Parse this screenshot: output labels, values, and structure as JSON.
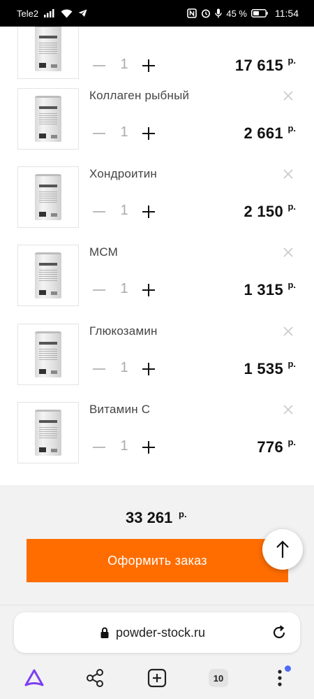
{
  "status_bar": {
    "carrier": "Tele2",
    "battery": "45 %",
    "time": "11:54"
  },
  "cart": {
    "currency": "р.",
    "items": [
      {
        "name": "",
        "qty": "1",
        "price": "17 615"
      },
      {
        "name": "Коллаген рыбный",
        "qty": "1",
        "price": "2 661"
      },
      {
        "name": "Хондроитин",
        "qty": "1",
        "price": "2 150"
      },
      {
        "name": "МСМ",
        "qty": "1",
        "price": "1 315"
      },
      {
        "name": "Глюкозамин",
        "qty": "1",
        "price": "1 535"
      },
      {
        "name": "Витамин С",
        "qty": "1",
        "price": "776"
      }
    ]
  },
  "summary": {
    "total": "33 261",
    "currency": "р.",
    "checkout_label": "Оформить заказ"
  },
  "browser": {
    "url": "powder-stock.ru",
    "tabs_count": "10"
  },
  "colors": {
    "accent": "#ff6d00",
    "browser_accent": "#7b3ff2",
    "notification_dot": "#4f6cf7"
  },
  "icons": {
    "remove": "close-icon",
    "minus": "minus-icon",
    "plus": "plus-icon",
    "scroll_top": "arrow-up-icon",
    "lock": "lock-icon",
    "reload": "reload-icon",
    "assistant": "alice-icon",
    "share": "share-icon",
    "new_tab": "new-tab-icon",
    "tabs": "tabs-icon",
    "menu": "more-vertical-icon"
  }
}
